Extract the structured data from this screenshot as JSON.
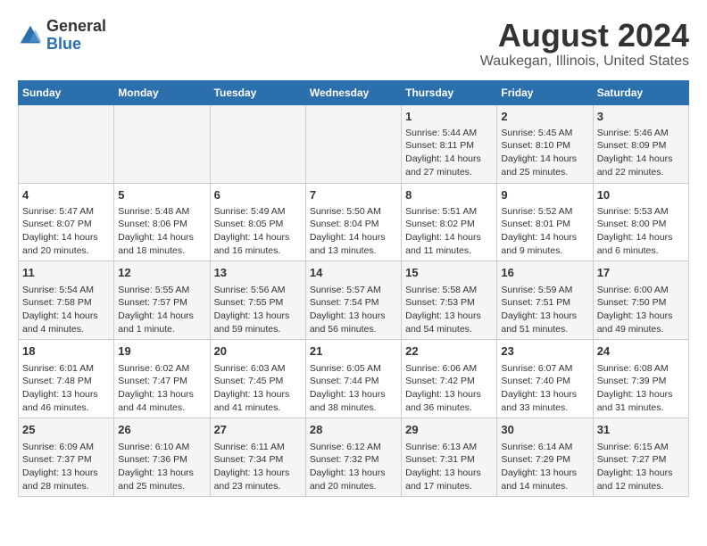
{
  "logo": {
    "text_general": "General",
    "text_blue": "Blue"
  },
  "title": "August 2024",
  "subtitle": "Waukegan, Illinois, United States",
  "days_of_week": [
    "Sunday",
    "Monday",
    "Tuesday",
    "Wednesday",
    "Thursday",
    "Friday",
    "Saturday"
  ],
  "weeks": [
    [
      {
        "day": "",
        "info": ""
      },
      {
        "day": "",
        "info": ""
      },
      {
        "day": "",
        "info": ""
      },
      {
        "day": "",
        "info": ""
      },
      {
        "day": "1",
        "info": "Sunrise: 5:44 AM\nSunset: 8:11 PM\nDaylight: 14 hours and 27 minutes."
      },
      {
        "day": "2",
        "info": "Sunrise: 5:45 AM\nSunset: 8:10 PM\nDaylight: 14 hours and 25 minutes."
      },
      {
        "day": "3",
        "info": "Sunrise: 5:46 AM\nSunset: 8:09 PM\nDaylight: 14 hours and 22 minutes."
      }
    ],
    [
      {
        "day": "4",
        "info": "Sunrise: 5:47 AM\nSunset: 8:07 PM\nDaylight: 14 hours and 20 minutes."
      },
      {
        "day": "5",
        "info": "Sunrise: 5:48 AM\nSunset: 8:06 PM\nDaylight: 14 hours and 18 minutes."
      },
      {
        "day": "6",
        "info": "Sunrise: 5:49 AM\nSunset: 8:05 PM\nDaylight: 14 hours and 16 minutes."
      },
      {
        "day": "7",
        "info": "Sunrise: 5:50 AM\nSunset: 8:04 PM\nDaylight: 14 hours and 13 minutes."
      },
      {
        "day": "8",
        "info": "Sunrise: 5:51 AM\nSunset: 8:02 PM\nDaylight: 14 hours and 11 minutes."
      },
      {
        "day": "9",
        "info": "Sunrise: 5:52 AM\nSunset: 8:01 PM\nDaylight: 14 hours and 9 minutes."
      },
      {
        "day": "10",
        "info": "Sunrise: 5:53 AM\nSunset: 8:00 PM\nDaylight: 14 hours and 6 minutes."
      }
    ],
    [
      {
        "day": "11",
        "info": "Sunrise: 5:54 AM\nSunset: 7:58 PM\nDaylight: 14 hours and 4 minutes."
      },
      {
        "day": "12",
        "info": "Sunrise: 5:55 AM\nSunset: 7:57 PM\nDaylight: 14 hours and 1 minute."
      },
      {
        "day": "13",
        "info": "Sunrise: 5:56 AM\nSunset: 7:55 PM\nDaylight: 13 hours and 59 minutes."
      },
      {
        "day": "14",
        "info": "Sunrise: 5:57 AM\nSunset: 7:54 PM\nDaylight: 13 hours and 56 minutes."
      },
      {
        "day": "15",
        "info": "Sunrise: 5:58 AM\nSunset: 7:53 PM\nDaylight: 13 hours and 54 minutes."
      },
      {
        "day": "16",
        "info": "Sunrise: 5:59 AM\nSunset: 7:51 PM\nDaylight: 13 hours and 51 minutes."
      },
      {
        "day": "17",
        "info": "Sunrise: 6:00 AM\nSunset: 7:50 PM\nDaylight: 13 hours and 49 minutes."
      }
    ],
    [
      {
        "day": "18",
        "info": "Sunrise: 6:01 AM\nSunset: 7:48 PM\nDaylight: 13 hours and 46 minutes."
      },
      {
        "day": "19",
        "info": "Sunrise: 6:02 AM\nSunset: 7:47 PM\nDaylight: 13 hours and 44 minutes."
      },
      {
        "day": "20",
        "info": "Sunrise: 6:03 AM\nSunset: 7:45 PM\nDaylight: 13 hours and 41 minutes."
      },
      {
        "day": "21",
        "info": "Sunrise: 6:05 AM\nSunset: 7:44 PM\nDaylight: 13 hours and 38 minutes."
      },
      {
        "day": "22",
        "info": "Sunrise: 6:06 AM\nSunset: 7:42 PM\nDaylight: 13 hours and 36 minutes."
      },
      {
        "day": "23",
        "info": "Sunrise: 6:07 AM\nSunset: 7:40 PM\nDaylight: 13 hours and 33 minutes."
      },
      {
        "day": "24",
        "info": "Sunrise: 6:08 AM\nSunset: 7:39 PM\nDaylight: 13 hours and 31 minutes."
      }
    ],
    [
      {
        "day": "25",
        "info": "Sunrise: 6:09 AM\nSunset: 7:37 PM\nDaylight: 13 hours and 28 minutes."
      },
      {
        "day": "26",
        "info": "Sunrise: 6:10 AM\nSunset: 7:36 PM\nDaylight: 13 hours and 25 minutes."
      },
      {
        "day": "27",
        "info": "Sunrise: 6:11 AM\nSunset: 7:34 PM\nDaylight: 13 hours and 23 minutes."
      },
      {
        "day": "28",
        "info": "Sunrise: 6:12 AM\nSunset: 7:32 PM\nDaylight: 13 hours and 20 minutes."
      },
      {
        "day": "29",
        "info": "Sunrise: 6:13 AM\nSunset: 7:31 PM\nDaylight: 13 hours and 17 minutes."
      },
      {
        "day": "30",
        "info": "Sunrise: 6:14 AM\nSunset: 7:29 PM\nDaylight: 13 hours and 14 minutes."
      },
      {
        "day": "31",
        "info": "Sunrise: 6:15 AM\nSunset: 7:27 PM\nDaylight: 13 hours and 12 minutes."
      }
    ]
  ]
}
